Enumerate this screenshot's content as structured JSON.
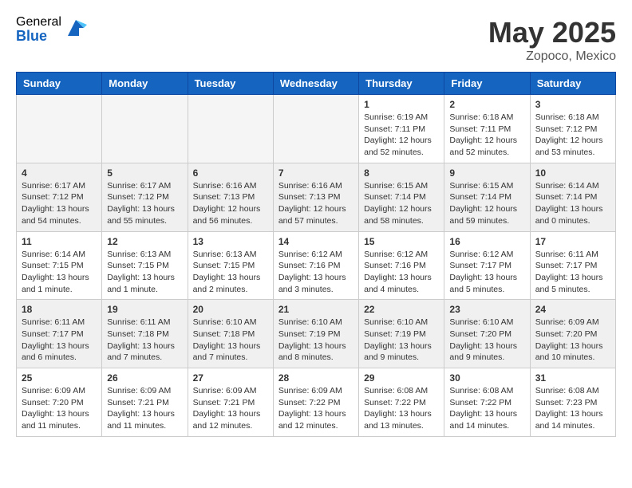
{
  "header": {
    "logo_general": "General",
    "logo_blue": "Blue",
    "title": "May 2025",
    "location": "Zopoco, Mexico"
  },
  "days_of_week": [
    "Sunday",
    "Monday",
    "Tuesday",
    "Wednesday",
    "Thursday",
    "Friday",
    "Saturday"
  ],
  "weeks": [
    {
      "days": [
        {
          "num": "",
          "empty": true
        },
        {
          "num": "",
          "empty": true
        },
        {
          "num": "",
          "empty": true
        },
        {
          "num": "",
          "empty": true
        },
        {
          "num": "1",
          "sunrise": "6:19 AM",
          "sunset": "7:11 PM",
          "daylight": "12 hours and 52 minutes."
        },
        {
          "num": "2",
          "sunrise": "6:18 AM",
          "sunset": "7:11 PM",
          "daylight": "12 hours and 52 minutes."
        },
        {
          "num": "3",
          "sunrise": "6:18 AM",
          "sunset": "7:12 PM",
          "daylight": "12 hours and 53 minutes."
        }
      ]
    },
    {
      "days": [
        {
          "num": "4",
          "sunrise": "6:17 AM",
          "sunset": "7:12 PM",
          "daylight": "13 hours and 54 minutes."
        },
        {
          "num": "5",
          "sunrise": "6:17 AM",
          "sunset": "7:12 PM",
          "daylight": "13 hours and 55 minutes."
        },
        {
          "num": "6",
          "sunrise": "6:16 AM",
          "sunset": "7:13 PM",
          "daylight": "12 hours and 56 minutes."
        },
        {
          "num": "7",
          "sunrise": "6:16 AM",
          "sunset": "7:13 PM",
          "daylight": "12 hours and 57 minutes."
        },
        {
          "num": "8",
          "sunrise": "6:15 AM",
          "sunset": "7:14 PM",
          "daylight": "12 hours and 58 minutes."
        },
        {
          "num": "9",
          "sunrise": "6:15 AM",
          "sunset": "7:14 PM",
          "daylight": "12 hours and 59 minutes."
        },
        {
          "num": "10",
          "sunrise": "6:14 AM",
          "sunset": "7:14 PM",
          "daylight": "13 hours and 0 minutes."
        }
      ]
    },
    {
      "days": [
        {
          "num": "11",
          "sunrise": "6:14 AM",
          "sunset": "7:15 PM",
          "daylight": "13 hours and 1 minute."
        },
        {
          "num": "12",
          "sunrise": "6:13 AM",
          "sunset": "7:15 PM",
          "daylight": "13 hours and 1 minute."
        },
        {
          "num": "13",
          "sunrise": "6:13 AM",
          "sunset": "7:15 PM",
          "daylight": "13 hours and 2 minutes."
        },
        {
          "num": "14",
          "sunrise": "6:12 AM",
          "sunset": "7:16 PM",
          "daylight": "13 hours and 3 minutes."
        },
        {
          "num": "15",
          "sunrise": "6:12 AM",
          "sunset": "7:16 PM",
          "daylight": "13 hours and 4 minutes."
        },
        {
          "num": "16",
          "sunrise": "6:12 AM",
          "sunset": "7:17 PM",
          "daylight": "13 hours and 5 minutes."
        },
        {
          "num": "17",
          "sunrise": "6:11 AM",
          "sunset": "7:17 PM",
          "daylight": "13 hours and 5 minutes."
        }
      ]
    },
    {
      "days": [
        {
          "num": "18",
          "sunrise": "6:11 AM",
          "sunset": "7:17 PM",
          "daylight": "13 hours and 6 minutes."
        },
        {
          "num": "19",
          "sunrise": "6:11 AM",
          "sunset": "7:18 PM",
          "daylight": "13 hours and 7 minutes."
        },
        {
          "num": "20",
          "sunrise": "6:10 AM",
          "sunset": "7:18 PM",
          "daylight": "13 hours and 7 minutes."
        },
        {
          "num": "21",
          "sunrise": "6:10 AM",
          "sunset": "7:19 PM",
          "daylight": "13 hours and 8 minutes."
        },
        {
          "num": "22",
          "sunrise": "6:10 AM",
          "sunset": "7:19 PM",
          "daylight": "13 hours and 9 minutes."
        },
        {
          "num": "23",
          "sunrise": "6:10 AM",
          "sunset": "7:20 PM",
          "daylight": "13 hours and 9 minutes."
        },
        {
          "num": "24",
          "sunrise": "6:09 AM",
          "sunset": "7:20 PM",
          "daylight": "13 hours and 10 minutes."
        }
      ]
    },
    {
      "days": [
        {
          "num": "25",
          "sunrise": "6:09 AM",
          "sunset": "7:20 PM",
          "daylight": "13 hours and 11 minutes."
        },
        {
          "num": "26",
          "sunrise": "6:09 AM",
          "sunset": "7:21 PM",
          "daylight": "13 hours and 11 minutes."
        },
        {
          "num": "27",
          "sunrise": "6:09 AM",
          "sunset": "7:21 PM",
          "daylight": "13 hours and 12 minutes."
        },
        {
          "num": "28",
          "sunrise": "6:09 AM",
          "sunset": "7:22 PM",
          "daylight": "13 hours and 12 minutes."
        },
        {
          "num": "29",
          "sunrise": "6:08 AM",
          "sunset": "7:22 PM",
          "daylight": "13 hours and 13 minutes."
        },
        {
          "num": "30",
          "sunrise": "6:08 AM",
          "sunset": "7:22 PM",
          "daylight": "13 hours and 14 minutes."
        },
        {
          "num": "31",
          "sunrise": "6:08 AM",
          "sunset": "7:23 PM",
          "daylight": "13 hours and 14 minutes."
        }
      ]
    }
  ]
}
